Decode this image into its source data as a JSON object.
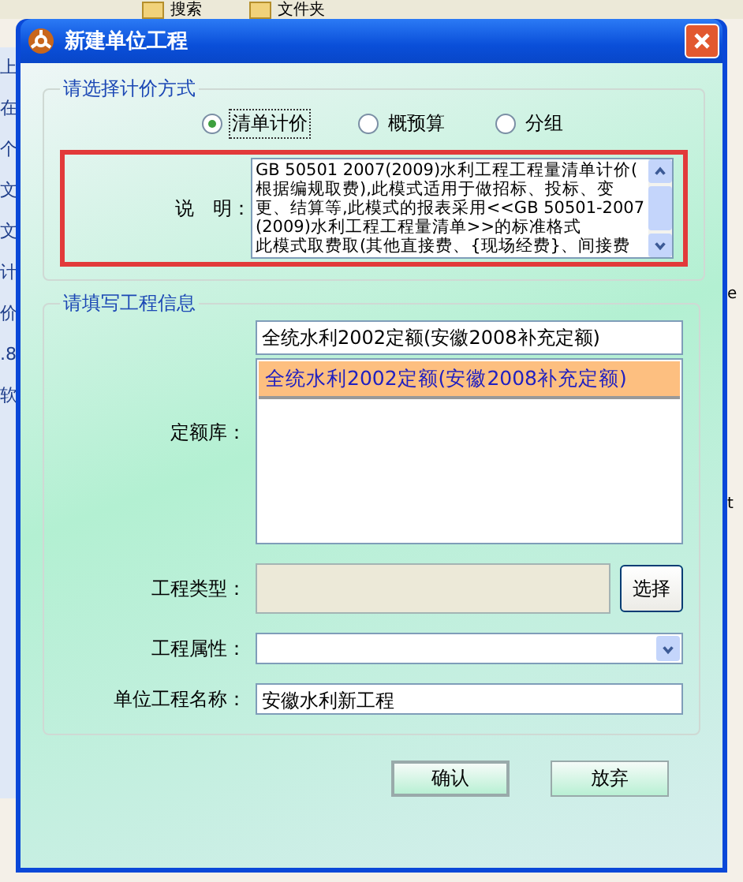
{
  "background": {
    "toolbar": [
      "搜索",
      "文件夹"
    ],
    "left_fragments": [
      "上",
      "在",
      "个",
      "文",
      "文",
      "计",
      "价",
      ".8",
      "软"
    ],
    "right_fragments": [
      "e",
      "t"
    ]
  },
  "window": {
    "title": "新建单位工程"
  },
  "pricing_group": {
    "title": "请选择计价方式",
    "options": [
      {
        "label": "清单计价",
        "selected": true
      },
      {
        "label": "概预算",
        "selected": false
      },
      {
        "label": "分组",
        "selected": false
      }
    ],
    "description_label": "说　明：",
    "description_lines": [
      "GB 50501 2007(2009)水利工程工程量清单计价(",
      "根据编规取费),此模式适用于做招标、投标、变",
      "更、结算等,此模式的报表采用<<GB 50501-2007",
      "(2009)水利工程工程量清单>>的标准格式",
      "此模式取费取(其他直接费、{现场经费}、间接费"
    ]
  },
  "info_group": {
    "title": "请填写工程信息",
    "quota_label": "定额库：",
    "quota_value": "全统水利2002定额(安徽2008补充定额)",
    "quota_items": [
      {
        "label": "全统水利2002定额(安徽2008补充定额)",
        "selected": true
      }
    ],
    "type_label": "工程类型：",
    "type_button": "选择",
    "attribute_label": "工程属性：",
    "name_label": "单位工程名称：",
    "name_value": "安徽水利新工程"
  },
  "buttons": [
    "确认",
    "放弃"
  ]
}
